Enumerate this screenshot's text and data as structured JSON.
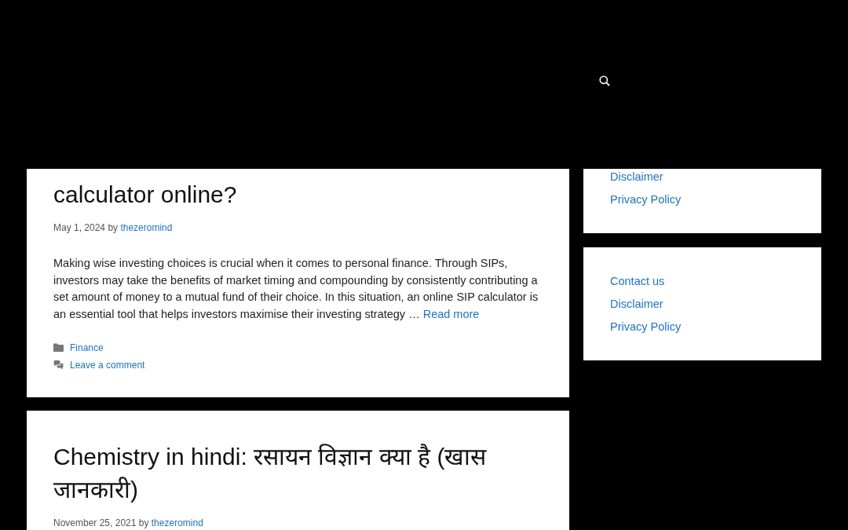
{
  "posts": [
    {
      "title": "calculator online?",
      "date": "May 1, 2024",
      "by": "by",
      "author": "thezeromind",
      "excerpt": "Making wise investing choices is crucial when it comes to personal finance. Through SIPs, investors may take the benefits of market timing and compounding by consistently contributing a set amount of money to a mutual fund of their choice. In this situation, an online SIP calculator is an essential tool that helps investors maximise their investing strategy …",
      "read_more": "Read more",
      "category": "Finance",
      "comments": "Leave a comment"
    },
    {
      "title": "Chemistry in hindi: रसायन विज्ञान क्या है (खास जानकारी)",
      "date": "November 25, 2021",
      "by": "by",
      "author": "thezeromind"
    }
  ],
  "sidebar": [
    {
      "links": [
        "Disclaimer",
        "Privacy Policy"
      ]
    },
    {
      "links": [
        "Contact us",
        "Disclaimer",
        "Privacy Policy"
      ]
    }
  ]
}
